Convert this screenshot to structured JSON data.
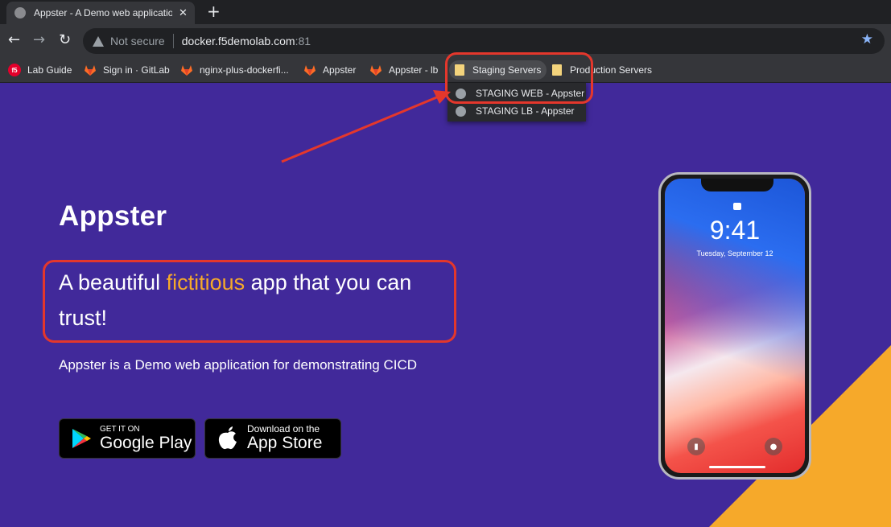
{
  "tab": {
    "title": "Appster - A Demo web application",
    "close": "✕",
    "new_tab": "+"
  },
  "toolbar": {
    "back": "←",
    "forward": "→",
    "reload": "↻",
    "security": "Not secure",
    "url_host": "docker.f5demolab.com",
    "url_port": ":81",
    "bookmark_star": "★"
  },
  "bookmarks": [
    {
      "label": "Lab Guide",
      "icon": "f5-icon"
    },
    {
      "label": "Sign in · GitLab",
      "icon": "gitlab-icon"
    },
    {
      "label": "nginx-plus-dockerfi...",
      "icon": "gitlab-icon"
    },
    {
      "label": "Appster",
      "icon": "gitlab-icon"
    },
    {
      "label": "Appster - lb",
      "icon": "gitlab-icon"
    },
    {
      "label": "Staging Servers",
      "icon": "folder-icon"
    },
    {
      "label": "Production Servers",
      "icon": "folder-icon"
    }
  ],
  "dropdown": [
    {
      "label": "STAGING WEB - Appster",
      "icon": "globe-icon"
    },
    {
      "label": "STAGING LB - Appster",
      "icon": "globe-icon"
    }
  ],
  "page": {
    "title": "Appster",
    "tagline_pre": "A beautiful ",
    "tagline_highlight": "fictitious",
    "tagline_post": " app that you can trust!",
    "description": "Appster is a Demo web application for demonstrating CICD",
    "google_play_small": "GET IT ON",
    "google_play_big": "Google Play",
    "app_store_small": "Download on the",
    "app_store_big": "App Store"
  },
  "phone": {
    "time": "9:41",
    "date": "Tuesday, September 12"
  },
  "colors": {
    "page_bg": "#41299a",
    "accent": "#f6a92a",
    "annotation": "#e4372c",
    "f5_brand": "#e4002b",
    "gitlab": "#fc6d26"
  }
}
